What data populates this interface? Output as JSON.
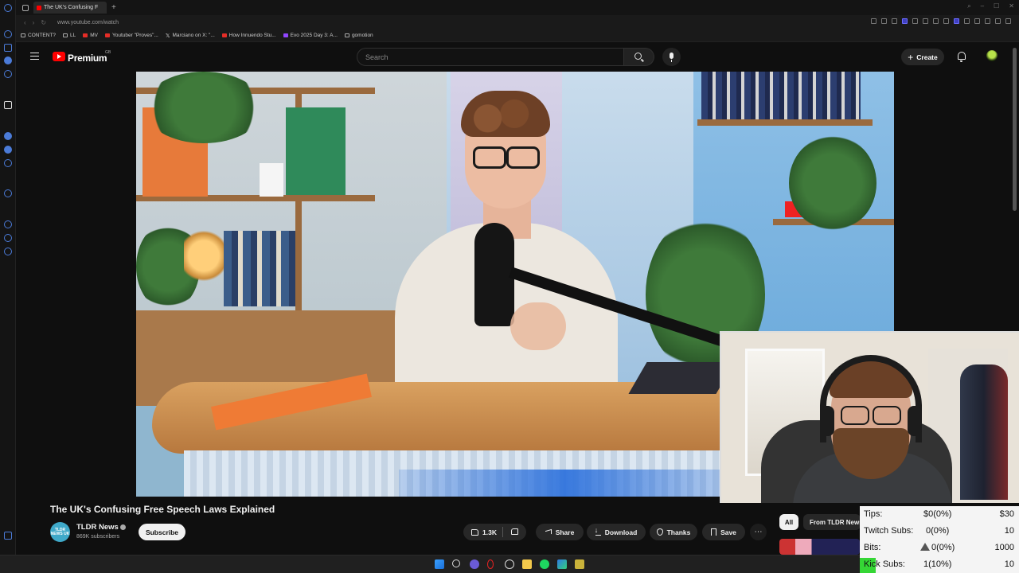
{
  "browser": {
    "tab_title": "The UK's Confusing F",
    "url": "www.youtube.com/watch",
    "bookmarks": [
      {
        "label": "CONTENT?",
        "icon": "folder-icon"
      },
      {
        "label": "LL",
        "icon": "bookmark-icon"
      },
      {
        "label": "MV",
        "icon": "youtube-icon"
      },
      {
        "label": "Youtuber \"Proves\"...",
        "icon": "youtube-icon"
      },
      {
        "label": "Marciano on X: \"...",
        "icon": "x-icon"
      },
      {
        "label": "How Innuendo Stu...",
        "icon": "youtube-icon"
      },
      {
        "label": "Evo 2025 Day 3: A...",
        "icon": "twitch-icon"
      },
      {
        "label": "gomotion",
        "icon": "folder-icon"
      }
    ]
  },
  "youtube": {
    "brand": "Premium",
    "region": "GB",
    "search_placeholder": "Search",
    "create_label": "Create"
  },
  "video": {
    "title": "The UK's Confusing Free Speech Laws Explained",
    "channel": {
      "name": "TLDR News",
      "subscribers": "869K subscribers",
      "avatar_text": "TLDR NEWS UK"
    },
    "subscribe_label": "Subscribe",
    "actions": {
      "likes": "1.3K",
      "share": "Share",
      "download": "Download",
      "thanks": "Thanks",
      "save": "Save",
      "more": "⋯"
    }
  },
  "recommendations": {
    "chips": [
      "All",
      "From TLDR News"
    ]
  },
  "stream_stats": {
    "rows": [
      {
        "label": "Tips:",
        "value": "$0(0%)",
        "goal": "$30"
      },
      {
        "label": "Twitch Subs:",
        "value": "0(0%)",
        "goal": "10"
      },
      {
        "label": "Bits:",
        "value": "0(0%)",
        "goal": "1000"
      },
      {
        "label": "Kick Subs:",
        "value": "1(10%)",
        "goal": "10"
      }
    ],
    "kick_progress": 0.1,
    "kick_color": "#35d635"
  },
  "colors": {
    "accent": "#ff0000",
    "background": "#0f0f0f"
  }
}
